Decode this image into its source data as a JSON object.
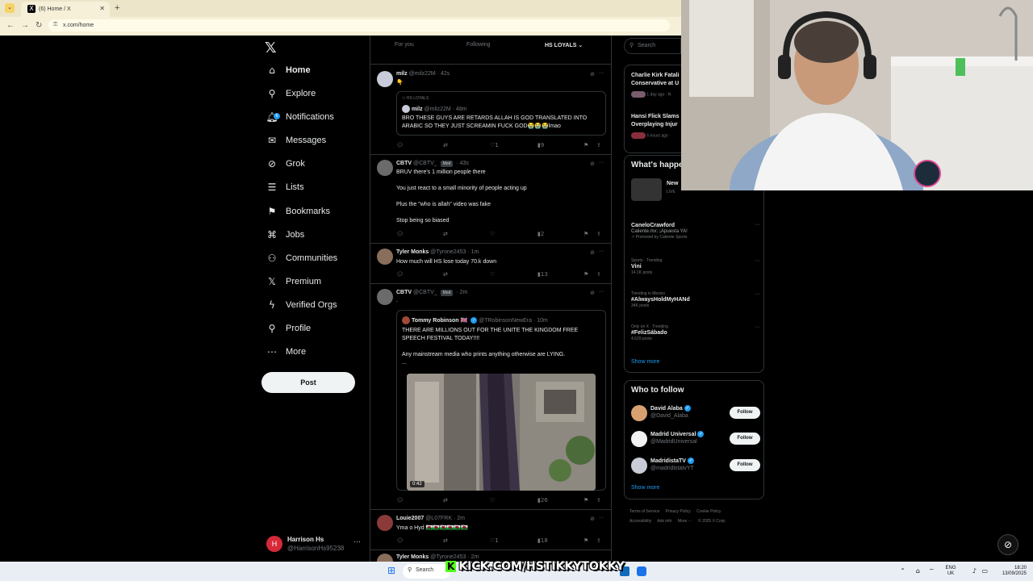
{
  "browser": {
    "tab_title": "(6) Home / X",
    "url": "x.com/home"
  },
  "sidebar": {
    "items": [
      {
        "label": "Home",
        "icon": "home-icon",
        "glyph": "⌂"
      },
      {
        "label": "Explore",
        "icon": "search-icon",
        "glyph": "⚲"
      },
      {
        "label": "Notifications",
        "icon": "bell-icon",
        "glyph": "🔔︎",
        "badge": "6"
      },
      {
        "label": "Messages",
        "icon": "envelope-icon",
        "glyph": "✉"
      },
      {
        "label": "Grok",
        "icon": "grok-icon",
        "glyph": "⊘"
      },
      {
        "label": "Lists",
        "icon": "list-icon",
        "glyph": "☰"
      },
      {
        "label": "Bookmarks",
        "icon": "bookmark-icon",
        "glyph": "⚑"
      },
      {
        "label": "Jobs",
        "icon": "briefcase-icon",
        "glyph": "⌘"
      },
      {
        "label": "Communities",
        "icon": "people-icon",
        "glyph": "⚇"
      },
      {
        "label": "Premium",
        "icon": "x-logo-icon",
        "glyph": "𝕏"
      },
      {
        "label": "Verified Orgs",
        "icon": "lightning-icon",
        "glyph": "ϟ"
      },
      {
        "label": "Profile",
        "icon": "person-icon",
        "glyph": "⚲"
      },
      {
        "label": "More",
        "icon": "more-circle-icon",
        "glyph": "⋯"
      }
    ],
    "post_label": "Post",
    "account": {
      "initial": "H",
      "name": "Harrison Hs",
      "handle": "@HarrisonHs95238"
    }
  },
  "timeline": {
    "tabs": [
      "For you",
      "Following",
      "HS LOYALS"
    ],
    "tweets": [
      {
        "name": "milz",
        "handle": "@milz22M",
        "time": "· 42s",
        "text": "👇",
        "quote": {
          "community": "HS LOYALS",
          "name": "milz",
          "handle": "@milz22M",
          "time": "· 48m",
          "text": "BRO THESE GUYS ARE RETARDS ALLAH IS GOD TRANSLATED INTO ARABIC SO THEY JUST SCREAMIN FUCK GOD😭😭😭lmao"
        },
        "likes": "1",
        "views": "9"
      },
      {
        "name": "CBTV",
        "handle": "@CBTV_",
        "tag": "Mod",
        "time": "· 43s",
        "lines": [
          "BRUV there's 1 million people there",
          "You just react to a small minority of people acting up",
          "Plus the \"who is allah\" video was fake",
          "Stop being so biased"
        ],
        "views": "2"
      },
      {
        "name": "Tyler Monks",
        "handle": "@Tyrone2453",
        "time": "· 1m",
        "text": "How much will HS lose today 70.k down",
        "views": "13"
      },
      {
        "name": "CBTV",
        "handle": "@CBTV_",
        "tag": "Mod",
        "time": "· 2m",
        "text": ".",
        "quote": {
          "name": "Tommy Robinson 🇬🇧",
          "handle": "@TRobinsonNewEra",
          "time": "· 10m",
          "text": "THERE ARE MILLIONS OUT FOR THE UNITE THE KINGDOM FREE SPEECH FESTIVAL TODAY!!!!",
          "text2": "Any mainstream media who prints anything otherwise are LYING.",
          "text3": "...",
          "duration": "0:42"
        },
        "views": "26"
      },
      {
        "name": "Louie2007",
        "handle": "@L07FRK",
        "time": "· 2m",
        "text": "Yma o Hyd 🏴󠁧󠁢󠁷󠁬󠁳󠁿🏴󠁧󠁢󠁷󠁬󠁳󠁿🏴󠁧󠁢󠁷󠁬󠁳󠁿🏴󠁧󠁢󠁷󠁬󠁳󠁿🏴󠁧󠁢󠁷󠁬󠁳󠁿🏴󠁧󠁢󠁷󠁬󠁳󠁿",
        "likes": "1",
        "views": "18"
      },
      {
        "name": "Tyler Monks",
        "handle": "@Tyrone2453",
        "time": "· 2m"
      }
    ]
  },
  "right": {
    "search_placeholder": "Search",
    "news": [
      {
        "title": "Charlie Kirk Fatali Conservative at U",
        "meta": "1 day ago · N"
      },
      {
        "title": "Hansi Flick Slams Overplaying Injur",
        "meta": "5 hours ago · "
      }
    ],
    "whats_happening": "What's happe",
    "live": {
      "title": "New",
      "status": "LIVE"
    },
    "trends": [
      {
        "context": "",
        "title": "CaneloCrawford",
        "sub": "Caliente.mx: ¡Apuesta YA!",
        "count": "Promoted by Caliente Sports"
      },
      {
        "context": "Sports · Trending",
        "title": "Vini",
        "count": "14.1K posts"
      },
      {
        "context": "Trending in Mexico",
        "title": "#AlwaysHoldMyHANd",
        "count": "34K posts"
      },
      {
        "context": "Only on X · Trending",
        "title": "#FelizSábado",
        "count": "4,629 posts"
      }
    ],
    "show_more": "Show more",
    "who_to_follow": "Who to follow",
    "follow_label": "Follow",
    "accounts": [
      {
        "name": "David Alaba",
        "handle": "@David_Alaba"
      },
      {
        "name": "Madrid Universal",
        "handle": "@MadridUniversal"
      },
      {
        "name": "MadridistaTV",
        "handle": "@madridistatvYT"
      }
    ],
    "footer": [
      "Terms of Service",
      "Privacy Policy",
      "Cookie Policy",
      "Accessibility",
      "Ads info",
      "More ···",
      "© 2025 X Corp."
    ]
  },
  "overlay": {
    "kick": "KICK.COM/HSTIKKYTOKKY",
    "kick_icon": "K"
  },
  "taskbar": {
    "search": "Search",
    "lang_top": "ENG",
    "lang_bottom": "UK",
    "time": "18:20",
    "date": "13/09/2025"
  },
  "colors": {
    "accent": "#1d9bf0",
    "bg": "#000000",
    "border": "#2f3336",
    "kick_green": "#53fc18"
  }
}
